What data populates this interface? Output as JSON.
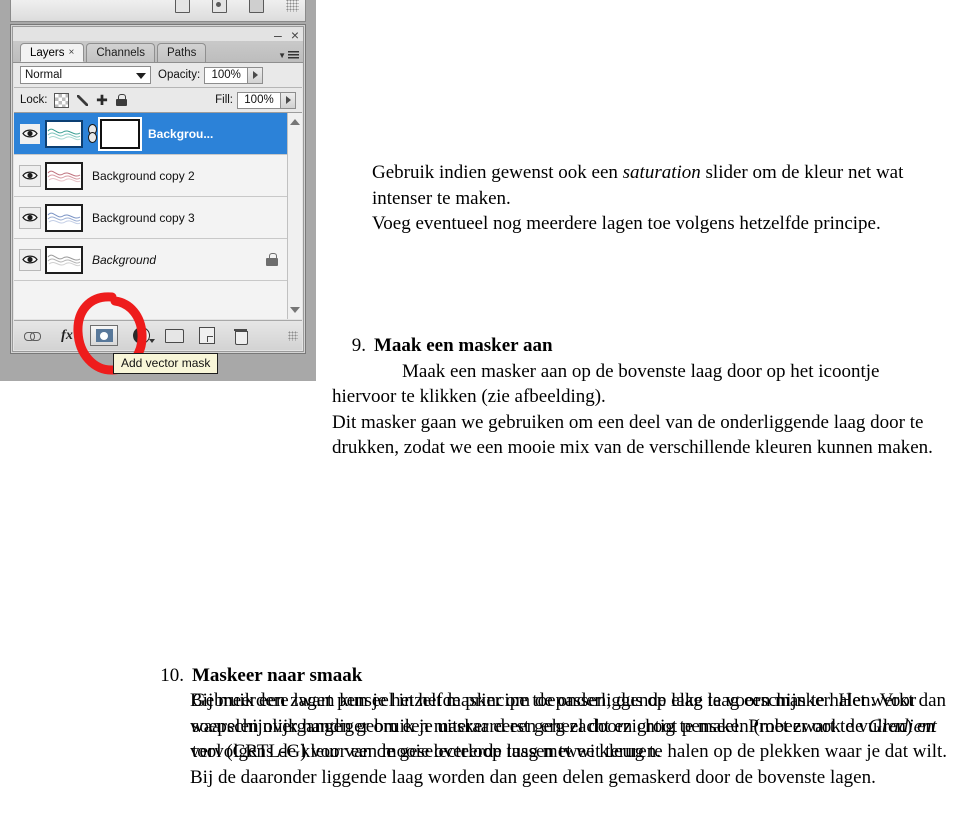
{
  "document": {
    "language": "nl",
    "blocks": {
      "intro": {
        "line1_pre": "Gebruik indien gewenst ook een ",
        "line1_em": "saturation",
        "line1_post": " slider om de kleur net wat intenser te maken.",
        "line2": "Voeg eventueel nog meerdere lagen toe volgens hetzelfde principe."
      },
      "item9": {
        "number": "9.",
        "heading": "Maak een masker aan",
        "body_line1": "Maak een masker aan op de bovenste laag door op het icoontje",
        "body_line2": "hiervoor te klikken (zie afbeelding).",
        "body_line3": "Dit masker gaan we gebruiken om een deel van de onderliggende laag door te drukken, zodat we een mooie mix van de verschillende kleuren kunnen maken."
      },
      "item10": {
        "number": "10.",
        "heading": "Maskeer naar smaak",
        "body_pre": "Gebruik een zwart penseel in het masker om de onderliggende laag te voorschijn te halen. Voor soepelen overgangen gebruik je uiteraard een erg zacht en groot penseel. Probeer ook de ",
        "body_em": "Gradient",
        "body_post": " tool (CRTL-G) voor een mooie overloop tussen twee kleuren."
      },
      "final": {
        "text": "Bij meerdere lagen kun je hetzelfde principe toepassen; dus op elke laag een masker. Het werkt dan waarschijnlijk handiger om een masker eerst geheel doorzichtig te maken (met zwart te vullen) en vervolgens de kleur van de geselecteerde laag met wit terug te halen op de plekken waar je dat wilt. Bij de daaronder liggende laag worden dan geen delen gemaskerd door de bovenste lagen."
      }
    }
  },
  "photoshop": {
    "window": {
      "minimize_label": "–",
      "close_label": "×"
    },
    "tabs": [
      {
        "label": "Layers",
        "active": true,
        "close": "×"
      },
      {
        "label": "Channels",
        "active": false
      },
      {
        "label": "Paths",
        "active": false
      }
    ],
    "panel_menu_icon": "panel-menu-icon",
    "blend": {
      "mode": "Normal",
      "opacity_label": "Opacity:",
      "opacity_value": "100%"
    },
    "lock": {
      "label": "Lock:",
      "icons": [
        "lock-transparent-pixels-icon",
        "lock-image-pixels-icon",
        "lock-position-icon",
        "lock-all-icon"
      ],
      "fill_label": "Fill:",
      "fill_value": "100%"
    },
    "layers": [
      {
        "name": "Backgrou...",
        "selected": true,
        "visible": true,
        "has_mask": true,
        "linked": true,
        "locked": false,
        "italic": false,
        "thumb_color": "#3a9e93"
      },
      {
        "name": "Background copy 2",
        "selected": false,
        "visible": true,
        "has_mask": false,
        "linked": false,
        "locked": false,
        "italic": false,
        "thumb_color": "#c0737f"
      },
      {
        "name": "Background copy 3",
        "selected": false,
        "visible": true,
        "has_mask": false,
        "linked": false,
        "locked": false,
        "italic": false,
        "thumb_color": "#7a93c4"
      },
      {
        "name": "Background",
        "selected": false,
        "visible": true,
        "has_mask": false,
        "linked": false,
        "locked": true,
        "italic": true,
        "thumb_color": "#9a9a9a"
      }
    ],
    "bottom_buttons": [
      {
        "name": "link-layers-icon",
        "label": "Link layers"
      },
      {
        "name": "layer-style-fx-icon",
        "label": "fx"
      },
      {
        "name": "add-layer-mask-icon",
        "label": "Add layer mask",
        "highlighted": true
      },
      {
        "name": "new-adjustment-layer-icon",
        "label": "Create new fill or adjustment layer"
      },
      {
        "name": "new-group-icon",
        "label": "Create a new group"
      },
      {
        "name": "new-layer-icon",
        "label": "Create a new layer"
      },
      {
        "name": "delete-layer-icon",
        "label": "Delete layer"
      }
    ],
    "tooltip": "Add vector mask",
    "annotation": {
      "type": "hand-drawn-circle",
      "color": "#ee1c1c",
      "target": "add-layer-mask-icon"
    },
    "colors": {
      "selection_blue": "#2c82d8",
      "panel_bg": "#e3e3e3",
      "list_bg": "#f3f3f3",
      "tooltip_bg": "#f8f6d8",
      "annotation_red": "#ee1c1c"
    }
  }
}
